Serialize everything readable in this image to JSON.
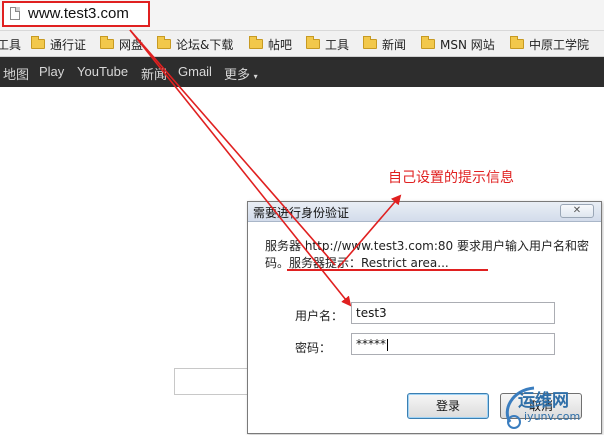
{
  "browser": {
    "url": "www.test3.com"
  },
  "bookmarks": [
    {
      "label": "工具",
      "folder": false
    },
    {
      "label": "通行证",
      "folder": true
    },
    {
      "label": "网盘",
      "folder": true
    },
    {
      "label": "论坛&下载",
      "folder": true
    },
    {
      "label": "帖吧",
      "folder": true
    },
    {
      "label": "工具",
      "folder": true
    },
    {
      "label": "新闻",
      "folder": true
    },
    {
      "label": "MSN 网站",
      "folder": true
    },
    {
      "label": "中原工学院",
      "folder": true
    }
  ],
  "google_bar": {
    "items": [
      "地图",
      "Play",
      "YouTube",
      "新闻",
      "Gmail",
      "更多"
    ],
    "more_caret": "▾"
  },
  "annotation": {
    "text": "自己设置的提示信息",
    "color": "#e02020"
  },
  "dialog": {
    "title": "需要进行身份验证",
    "close": "✕",
    "message_line1": "服务器 http://www.test3.com:80 要求用户输入用户名和密",
    "message_line2": "码。服务器提示：Restrict area...",
    "username_label": "用户名：",
    "username_value": "test3",
    "password_label": "密码：",
    "password_value": "*****",
    "login_button": "登录",
    "cancel_button": "取消"
  },
  "watermark": {
    "line1": "运维网",
    "line2": "iyunv.com"
  }
}
